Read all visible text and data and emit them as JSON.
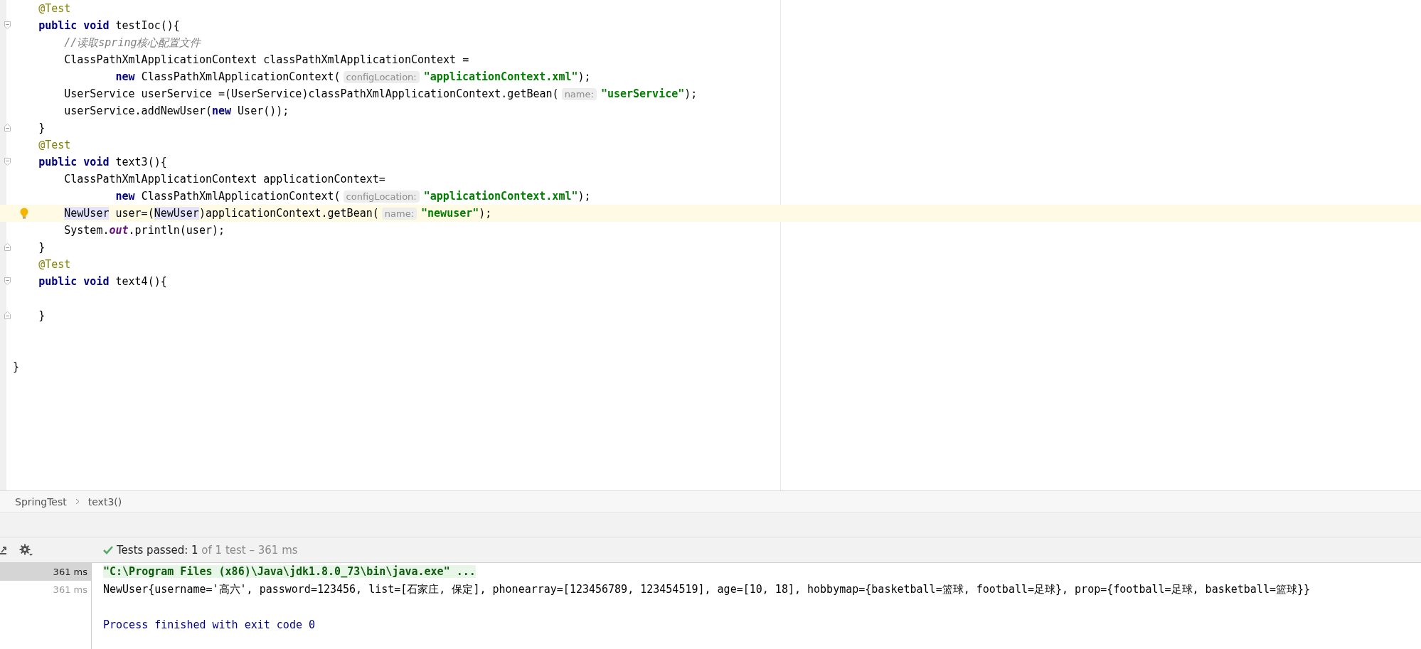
{
  "editor": {
    "lines": [
      {
        "kind": "plain",
        "current": false,
        "tokens": [
          {
            "kind": "annotation",
            "text": "    @Test"
          }
        ]
      },
      {
        "kind": "fold-start",
        "current": false,
        "tokens": [
          {
            "kind": "kw",
            "text": "    public void "
          },
          {
            "kind": "plain",
            "text": "testIoc(){"
          }
        ]
      },
      {
        "kind": "plain",
        "current": false,
        "tokens": [
          {
            "kind": "comment",
            "text": "        //读取spring核心配置文件"
          }
        ]
      },
      {
        "kind": "plain",
        "current": false,
        "tokens": [
          {
            "kind": "plain",
            "text": "        ClassPathXmlApplicationContext classPathXmlApplicationContext ="
          }
        ]
      },
      {
        "kind": "plain",
        "current": false,
        "tokens": [
          {
            "kind": "kw",
            "text": "                new "
          },
          {
            "kind": "plain",
            "text": "ClassPathXmlApplicationContext("
          },
          {
            "kind": "hint",
            "text": "configLocation:"
          },
          {
            "kind": "string",
            "text": "\"applicationContext.xml\""
          },
          {
            "kind": "plain",
            "text": ");"
          }
        ]
      },
      {
        "kind": "plain",
        "current": false,
        "tokens": [
          {
            "kind": "plain",
            "text": "        UserService userService =(UserService)classPathXmlApplicationContext.getBean("
          },
          {
            "kind": "hint",
            "text": "name:"
          },
          {
            "kind": "string",
            "text": "\"userService\""
          },
          {
            "kind": "plain",
            "text": ");"
          }
        ]
      },
      {
        "kind": "plain",
        "current": false,
        "tokens": [
          {
            "kind": "plain",
            "text": "        userService.addNewUser("
          },
          {
            "kind": "kw",
            "text": "new "
          },
          {
            "kind": "plain",
            "text": "User());"
          }
        ]
      },
      {
        "kind": "fold-end",
        "current": false,
        "tokens": [
          {
            "kind": "plain",
            "text": "    }"
          }
        ]
      },
      {
        "kind": "plain",
        "current": false,
        "tokens": [
          {
            "kind": "annotation",
            "text": "    @Test"
          }
        ]
      },
      {
        "kind": "fold-start",
        "current": false,
        "tokens": [
          {
            "kind": "kw",
            "text": "    public void "
          },
          {
            "kind": "plain",
            "text": "text3(){"
          }
        ]
      },
      {
        "kind": "plain",
        "current": false,
        "tokens": [
          {
            "kind": "plain",
            "text": "        ClassPathXmlApplicationContext applicationContext="
          }
        ]
      },
      {
        "kind": "plain",
        "current": false,
        "tokens": [
          {
            "kind": "kw",
            "text": "                new "
          },
          {
            "kind": "plain",
            "text": "ClassPathXmlApplicationContext("
          },
          {
            "kind": "hint",
            "text": "configLocation:"
          },
          {
            "kind": "string",
            "text": "\"applicationContext.xml\""
          },
          {
            "kind": "plain",
            "text": ");"
          }
        ]
      },
      {
        "kind": "bulb",
        "current": true,
        "tokens": [
          {
            "kind": "ref",
            "text": "        NewUser"
          },
          {
            "kind": "plain",
            "text": " user=("
          },
          {
            "kind": "ref",
            "text": "NewUser"
          },
          {
            "kind": "plain",
            "text": ")applicationContext.getBean("
          },
          {
            "kind": "hint",
            "text": "name:"
          },
          {
            "kind": "string",
            "text": "\"newuser\""
          },
          {
            "kind": "plain",
            "text": ");"
          }
        ]
      },
      {
        "kind": "plain",
        "current": false,
        "tokens": [
          {
            "kind": "plain",
            "text": "        System."
          },
          {
            "kind": "static",
            "text": "out"
          },
          {
            "kind": "plain",
            "text": ".println(user);"
          }
        ]
      },
      {
        "kind": "fold-end",
        "current": false,
        "tokens": [
          {
            "kind": "plain",
            "text": "    }"
          }
        ]
      },
      {
        "kind": "plain",
        "current": false,
        "tokens": [
          {
            "kind": "annotation",
            "text": "    @Test"
          }
        ]
      },
      {
        "kind": "fold-start",
        "current": false,
        "tokens": [
          {
            "kind": "kw",
            "text": "    public void "
          },
          {
            "kind": "plain",
            "text": "text4(){"
          }
        ]
      },
      {
        "kind": "plain",
        "current": false
      },
      {
        "kind": "fold-end",
        "current": false,
        "tokens": [
          {
            "kind": "plain",
            "text": "    }"
          }
        ]
      },
      {
        "kind": "plain",
        "current": false
      },
      {
        "kind": "plain",
        "current": false
      },
      {
        "kind": "plain",
        "current": false,
        "tokens": [
          {
            "kind": "plain",
            "text": "}"
          }
        ]
      }
    ]
  },
  "breadcrumbs": [
    "SpringTest",
    "text3()"
  ],
  "test_status": {
    "passed": "Tests passed: 1",
    "detail": " of 1 test – 361 ms"
  },
  "test_tree": [
    {
      "time": "361 ms",
      "selected": true
    },
    {
      "time": "361 ms",
      "selected": false
    }
  ],
  "console": [
    {
      "kind": "command",
      "text": "\"C:\\Program Files (x86)\\Java\\jdk1.8.0_73\\bin\\java.exe\" ..."
    },
    {
      "kind": "output",
      "text": "NewUser{username='高六', password=123456, list=[石家庄, 保定], phonearray=[123456789, 123454519], age=[10, 18], hobbymap={basketball=篮球, football=足球}, prop={football=足球, basketball=篮球}}"
    },
    {
      "kind": "blank"
    },
    {
      "kind": "exit",
      "text": "Process finished with exit code 0"
    }
  ]
}
